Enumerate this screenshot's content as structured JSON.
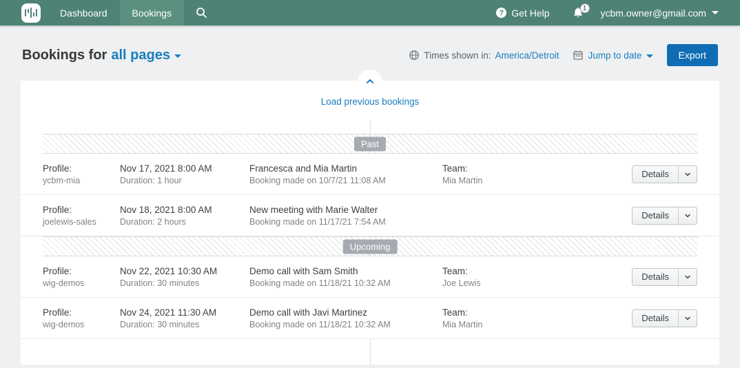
{
  "colors": {
    "topbar_green": "#4d8274",
    "active_tab_green": "#5b9080",
    "link_blue": "#1a7dc0",
    "export_blue": "#0e6db4",
    "section_badge_gray": "#a6abb2"
  },
  "topbar": {
    "nav": [
      {
        "label": "Dashboard"
      },
      {
        "label": "Bookings"
      }
    ],
    "get_help": "Get Help",
    "notification_count": "1",
    "account_email": "ycbm.owner@gmail.com"
  },
  "header": {
    "title_prefix": "Bookings for",
    "scope_selector": "all pages",
    "times_shown_label": "Times shown in:",
    "timezone": "America/Detroit",
    "jump_to_date": "Jump to date",
    "export_label": "Export"
  },
  "bookings": {
    "load_previous": "Load previous bookings",
    "profile_label": "Profile:",
    "details_label": "Details",
    "sections": [
      {
        "label": "Past",
        "rows": [
          {
            "profile": "ycbm-mia",
            "datetime": "Nov 17, 2021 8:00 AM",
            "duration": "Duration: 1 hour",
            "title": "Francesca and Mia Martin",
            "made": "Booking made on 10/7/21 11:08 AM",
            "team_label": "Team:",
            "team": "Mia Martin"
          },
          {
            "profile": "joelewis-sales",
            "datetime": "Nov 18, 2021 8:00 AM",
            "duration": "Duration: 2 hours",
            "title": "New meeting with Marie Walter",
            "made": "Booking made on 11/17/21 7:54 AM",
            "team_label": "",
            "team": ""
          }
        ]
      },
      {
        "label": "Upcoming",
        "rows": [
          {
            "profile": "wig-demos",
            "datetime": "Nov 22, 2021 10:30 AM",
            "duration": "Duration: 30 minutes",
            "title": "Demo call with Sam Smith",
            "made": "Booking made on 11/18/21 10:32 AM",
            "team_label": "Team:",
            "team": "Joe Lewis"
          },
          {
            "profile": "wig-demos",
            "datetime": "Nov 24, 2021 11:30 AM",
            "duration": "Duration: 30 minutes",
            "title": "Demo call with Javi Martinez",
            "made": "Booking made on 11/18/21 10:32 AM",
            "team_label": "Team:",
            "team": "Mia Martin"
          }
        ]
      }
    ]
  }
}
